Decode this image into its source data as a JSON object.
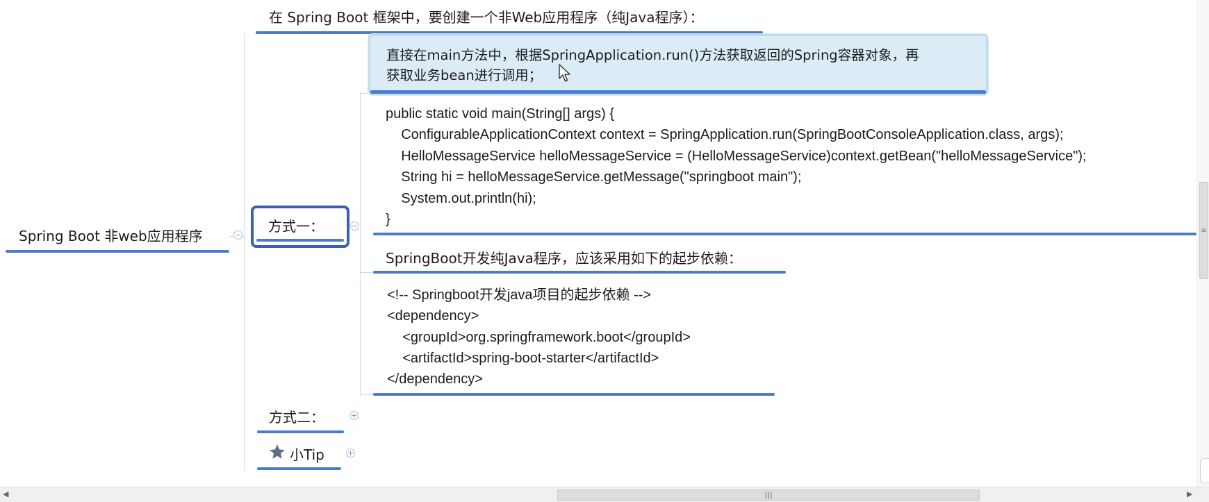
{
  "root": {
    "label": "Spring Boot 非web应用程序"
  },
  "header_topic": {
    "label": "在 Spring Boot 框架中，要创建一个非Web应用程序（纯Java程序）："
  },
  "method_one": {
    "label": "方式一：",
    "description_line1": "直接在main方法中，根据SpringApplication.run()方法获取返回的Spring容器对象，再",
    "description_line2": "获取业务bean进行调用；",
    "code_lines": [
      "public static void main(String[] args) {",
      "    ConfigurableApplicationContext context = SpringApplication.run(SpringBootConsoleApplication.class, args);",
      "    HelloMessageService helloMessageService = (HelloMessageService)context.getBean(\"helloMessageService\");",
      "    String hi = helloMessageService.getMessage(\"springboot main\");",
      "    System.out.println(hi);",
      "}"
    ],
    "dependency_title": "SpringBoot开发纯Java程序，应该采用如下的起步依赖：",
    "dependency_lines": [
      "<!-- Springboot开发java项目的起步依赖 -->",
      "<dependency>",
      "    <groupId>org.springframework.boot</groupId>",
      "    <artifactId>spring-boot-starter</artifactId>",
      "</dependency>"
    ]
  },
  "method_two": {
    "label": "方式二："
  },
  "tip": {
    "label": "小Tip"
  },
  "toggles": {
    "collapse": "−",
    "expand": "+"
  },
  "scrollbar": {
    "grip": "|||",
    "left_arrow": "◀",
    "right_arrow": "▶",
    "vgrip": "≡"
  },
  "icons": {
    "tip": "star-icon",
    "pointer": "mouse-cursor-icon"
  },
  "colors": {
    "accent": "#4a7cc9",
    "selected_border": "#3b5fb5",
    "highlight_fill": "#dcecf6",
    "connector": "#c7dcf2"
  }
}
